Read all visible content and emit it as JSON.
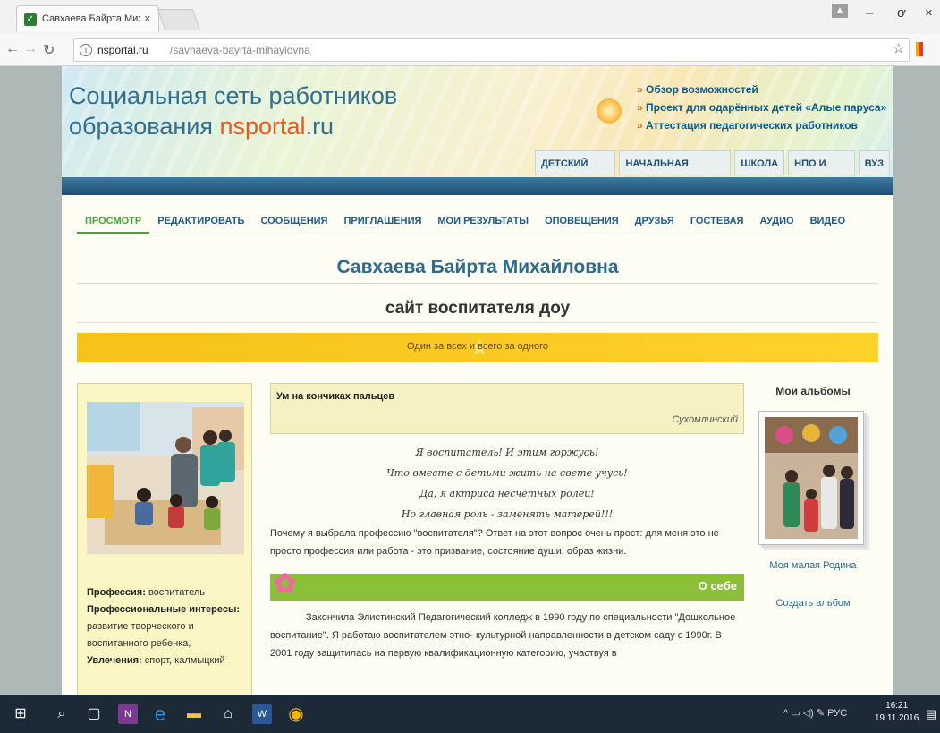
{
  "browser": {
    "tab_title": "Савхаева Байрта Михай",
    "tab_close": "×",
    "url_host": "nsportal.ru",
    "url_path": "/savhaeva-bayrta-mihaylovna",
    "window_controls": {
      "minimize": "–",
      "maximize": "ơ",
      "close": "×"
    }
  },
  "header": {
    "logo_line1": "Социальная сеть работников",
    "logo_line2_prefix": "образования ",
    "logo_ns": "ns",
    "logo_portal": "portal",
    "logo_ru": ".ru",
    "links": [
      "Обзор возможностей",
      "Проект для одарённых детей «Алые паруса»",
      "Аттестация педагогических работников"
    ],
    "levels": [
      "ДЕТСКИЙ САД",
      "НАЧАЛЬНАЯ ШКОЛА",
      "ШКОЛА",
      "НПО И СПО",
      "ВУЗ"
    ]
  },
  "menu": [
    "ПРОСМОТР",
    "РЕДАКТИРОВАТЬ",
    "СООБЩЕНИЯ",
    "ПРИГЛАШЕНИЯ",
    "МОИ РЕЗУЛЬТАТЫ",
    "ОПОВЕЩЕНИЯ",
    "ДРУЗЬЯ",
    "ГОСТЕВАЯ",
    "АУДИО",
    "ВИДЕО"
  ],
  "page": {
    "owner_name": "Савхаева Байрта Михайловна",
    "site_title": "сайт воспитателя доу",
    "motto": "Один за всех и всего за одного"
  },
  "profile": {
    "prof_label": "Профессия:",
    "prof_value": " воспитатель",
    "interests_label": "Профессиональные интересы:",
    "interests_value": " развитие творческого и воспитанного ребенка,",
    "hobbies_label": "Увлечения:",
    "hobbies_value": " спорт, калмыцкий"
  },
  "quote": {
    "title": "Ум на кончиках пальцев",
    "author": "Сухомлинский"
  },
  "poem": [
    "Я воспитатель! И этим горжусь!",
    "Что вместе с детьми жить на свете учусь!",
    "Да, я актриса несчетных ролей!",
    "Но главная роль - заменять матерей!!!"
  ],
  "intro": "Почему я выбрала профессию \"воспитателя\"? Ответ на этот вопрос очень прост: для меня это не просто профессия или работа - это призвание, состояние души, образ жизни.",
  "about": {
    "heading": "О себе",
    "text": "Закончила Элистинский Педагогический колледж в 1990 году  по специальности \"Дошкольное воспитание\". Я работаю воспитателем  этно- культурной направленности в детском саду с 1990г.  В 2001 году защитилась на первую квалификационную категорию, участвуя в"
  },
  "albums": {
    "title": "Мои альбомы",
    "album_name": "Моя малая Родина",
    "create": "Создать альбом"
  },
  "taskbar": {
    "lang": "РУС",
    "time": "16:21",
    "date": "19.11.2016"
  }
}
